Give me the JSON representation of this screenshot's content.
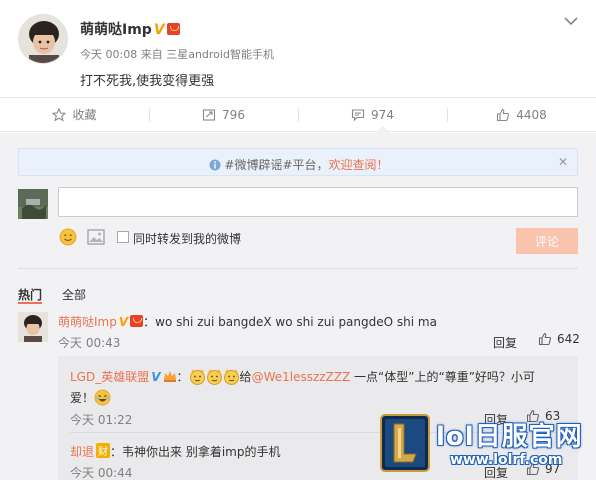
{
  "post": {
    "author": "萌萌哒Imp",
    "verified_mark": "V",
    "time": "今天 00:08",
    "source_prefix": "来自",
    "source": "三星android智能手机",
    "text": "打不死我,使我变得更强"
  },
  "actions": {
    "favorite": "收藏",
    "repost_count": "796",
    "comment_count": "974",
    "like_count": "4408"
  },
  "notice": {
    "prefix": "#微博辟谣#平台，",
    "highlight": "欢迎查阅！",
    "close": "✕"
  },
  "composer": {
    "input_value": "",
    "repost_label": "同时转发到我的微博",
    "submit_label": "评论"
  },
  "tabs": {
    "hot": "热门",
    "all": "全部"
  },
  "comments": [
    {
      "author": "萌萌哒Imp",
      "verified_mark": "V",
      "text": "：wo shi zui bangdeX wo shi zui pangdeO shi ma",
      "time": "今天 00:43",
      "reply_label": "回复",
      "likes": "642"
    }
  ],
  "replies": [
    {
      "author": "LGD_英雄联盟",
      "verified_mark": "V",
      "sep": "：",
      "text_prefix": "给",
      "mention": "@We1lesszzZZZ",
      "text_suffix": " 一点“体型”上的“尊重”好吗？小可",
      "text_line2": "爱！",
      "time": "今天 01:22",
      "reply_label": "回复",
      "likes": "63"
    },
    {
      "author": "却退",
      "badge": "财",
      "text": "：韦神你出来 别拿着imp的手机",
      "time": "今天 00:44",
      "reply_label": "回复",
      "likes": "97"
    }
  ],
  "watermark": {
    "title": "lol日服官网",
    "url": "www.lolrf.com"
  },
  "colors": {
    "accent": "#eb7350",
    "verified": "#f7a000",
    "submit_disabled": "#f9c3ad",
    "comment_bg": "#f2f2f5"
  },
  "icons": [
    "chevron-down-icon",
    "star-icon",
    "repost-icon",
    "comment-icon",
    "thumb-up-icon",
    "info-icon",
    "smile-icon",
    "image-icon",
    "vip-icon",
    "crown-icon",
    "cat-face-icon",
    "laugh-icon",
    "lol-logo-icon"
  ]
}
